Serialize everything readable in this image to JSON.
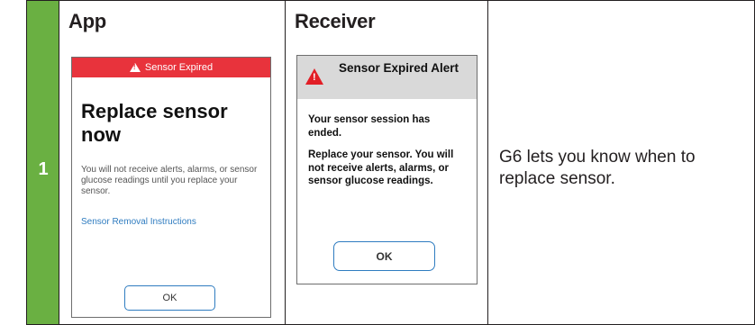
{
  "step": {
    "number": "1"
  },
  "columns": {
    "app_title": "App",
    "receiver_title": "Receiver"
  },
  "app_screen": {
    "banner": "Sensor Expired",
    "heading": "Replace sensor now",
    "body": "You will not receive alerts, alarms, or sensor glucose readings until you replace your sensor.",
    "link": "Sensor Removal Instructions",
    "ok_label": "OK",
    "banner_color": "#e8333c",
    "link_color": "#2f7cc0"
  },
  "receiver_screen": {
    "title": "Sensor Expired Alert",
    "message1": "Your sensor session has ended.",
    "message2": "Replace your sensor. You will not receive alerts, alarms, or sensor glucose readings.",
    "ok_label": "OK",
    "icon_color": "#e21e26"
  },
  "description": "G6 lets you know when to replace sensor.",
  "colors": {
    "step_green": "#6ab042"
  }
}
